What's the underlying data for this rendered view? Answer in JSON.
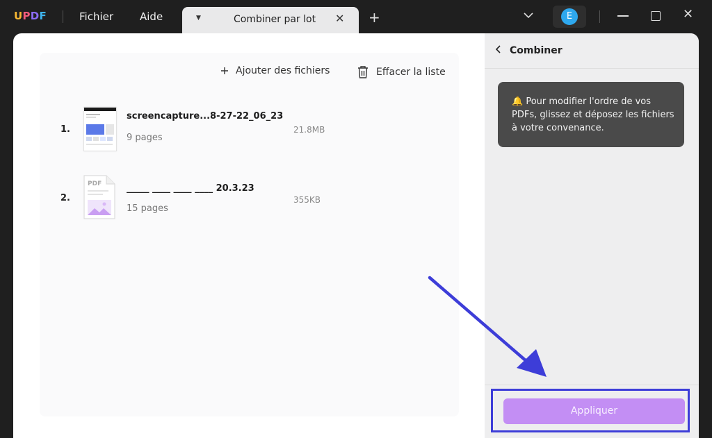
{
  "app": {
    "logo": [
      "U",
      "P",
      "D",
      "F"
    ]
  },
  "menu": {
    "file": "Fichier",
    "help": "Aide"
  },
  "tab": {
    "title": "Combiner par lot"
  },
  "user": {
    "initial": "E"
  },
  "toolbar": {
    "add_files": "Ajouter des fichiers",
    "clear_list": "Effacer la liste"
  },
  "files": [
    {
      "index": "1.",
      "name": "screencapture...8-27-22_06_23",
      "pages": "9 pages",
      "size": "21.8MB"
    },
    {
      "index": "2.",
      "name": "_____ ____ ____ ____ 20.3.23",
      "pages": "15 pages",
      "size": "355KB",
      "thumb_label": "PDF"
    }
  ],
  "panel": {
    "title": "Combiner",
    "tip": "Pour modifier l'ordre de vos PDFs, glissez et déposez les fichiers à votre convenance.",
    "apply": "Appliquer"
  },
  "colors": {
    "accent": "#c38ef4",
    "highlight": "#3d3dd8",
    "avatar": "#2ea8ee"
  }
}
